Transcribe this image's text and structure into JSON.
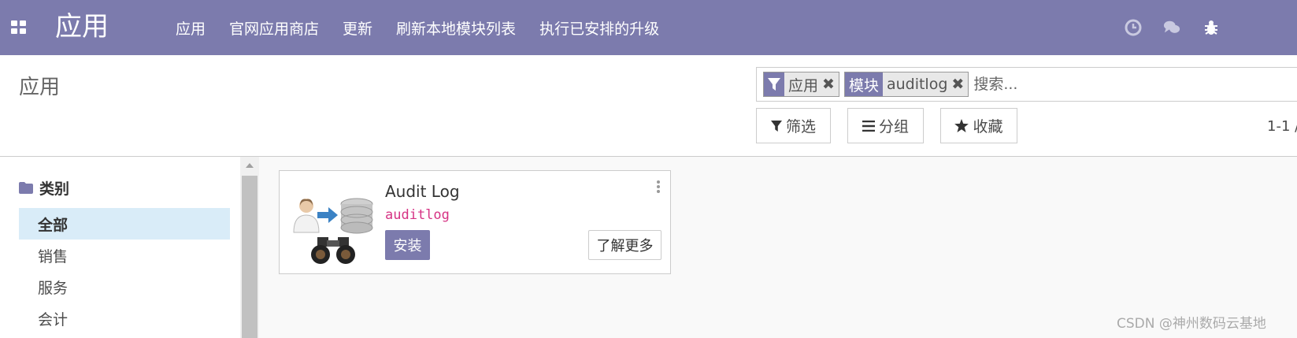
{
  "navbar": {
    "brand": "应用",
    "menu": [
      "应用",
      "官网应用商店",
      "更新",
      "刷新本地模块列表",
      "执行已安排的升级"
    ],
    "background": "#7c7bad"
  },
  "control_panel": {
    "title": "应用",
    "search": {
      "facets": [
        {
          "label_icon": "filter-icon",
          "value": "应用"
        },
        {
          "label": "模块",
          "value": "auditlog"
        }
      ],
      "placeholder": "搜索..."
    },
    "buttons": {
      "filter": "筛选",
      "group": "分组",
      "favorite": "收藏"
    },
    "pager": "1-1 /"
  },
  "sidebar": {
    "header": "类别",
    "items": [
      {
        "label": "全部",
        "active": true
      },
      {
        "label": "销售",
        "active": false
      },
      {
        "label": "服务",
        "active": false
      },
      {
        "label": "会计",
        "active": false
      }
    ]
  },
  "card": {
    "title": "Audit Log",
    "technical_name": "auditlog",
    "install_label": "安装",
    "learn_more_label": "了解更多"
  },
  "watermark": "CSDN @神州数码云基地"
}
